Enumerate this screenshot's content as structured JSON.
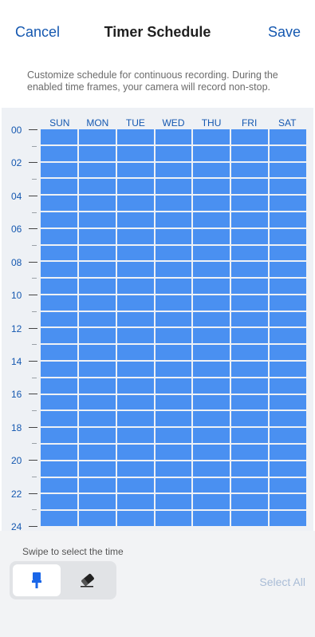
{
  "header": {
    "cancel_label": "Cancel",
    "title": "Timer Schedule",
    "save_label": "Save"
  },
  "description": "Customize schedule for continuous recording. During the enabled time frames, your camera will record non-stop.",
  "schedule": {
    "days": [
      "SUN",
      "MON",
      "TUE",
      "WED",
      "THU",
      "FRI",
      "SAT"
    ],
    "hour_labels": [
      "00",
      "02",
      "04",
      "06",
      "08",
      "10",
      "12",
      "14",
      "16",
      "18",
      "20",
      "22",
      "24"
    ],
    "all_selected": true,
    "selected_color": "#4a90f1"
  },
  "footer": {
    "hint": "Swipe to select the time",
    "tools": [
      {
        "icon": "brush-icon",
        "selected": true
      },
      {
        "icon": "eraser-icon",
        "selected": false
      }
    ],
    "select_all_label": "Select All"
  },
  "colors": {
    "accent": "#1558b0",
    "cell": "#4a90f1",
    "disabled_text": "#a9bcd6"
  }
}
